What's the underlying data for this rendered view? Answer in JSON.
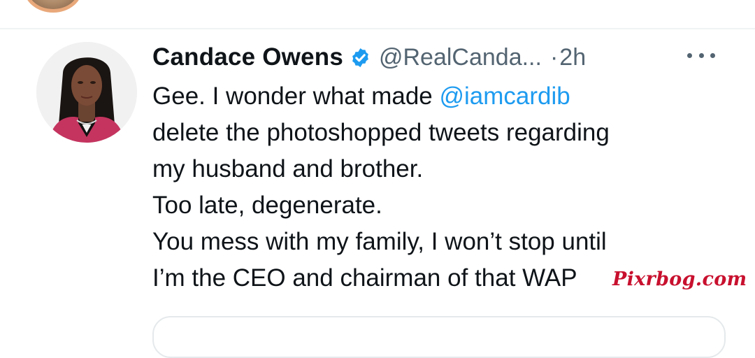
{
  "tweet": {
    "author_name": "Candace Owens",
    "handle": "@RealCanda...",
    "separator": "·",
    "time": "2h",
    "verified": true,
    "body": {
      "line1_prefix": "Gee. I wonder what made ",
      "line1_mention": "@iamcardib",
      "line2": "delete the photoshopped tweets regarding",
      "line3": "my husband and brother.",
      "line4": "Too late, degenerate.",
      "line5": "You mess with my family, I won’t stop until",
      "line6": "I’m the CEO and chairman of that WAP"
    }
  },
  "watermark": "Pixrbog.com",
  "colors": {
    "text": "#0f1419",
    "secondary": "#536471",
    "mention": "#1d9bf0",
    "verified_badge": "#1d9bf0",
    "watermark": "#c8102e",
    "divider": "#eff3f4"
  },
  "icons": {
    "verified": "verified-badge-icon",
    "more": "more-options-icon"
  }
}
